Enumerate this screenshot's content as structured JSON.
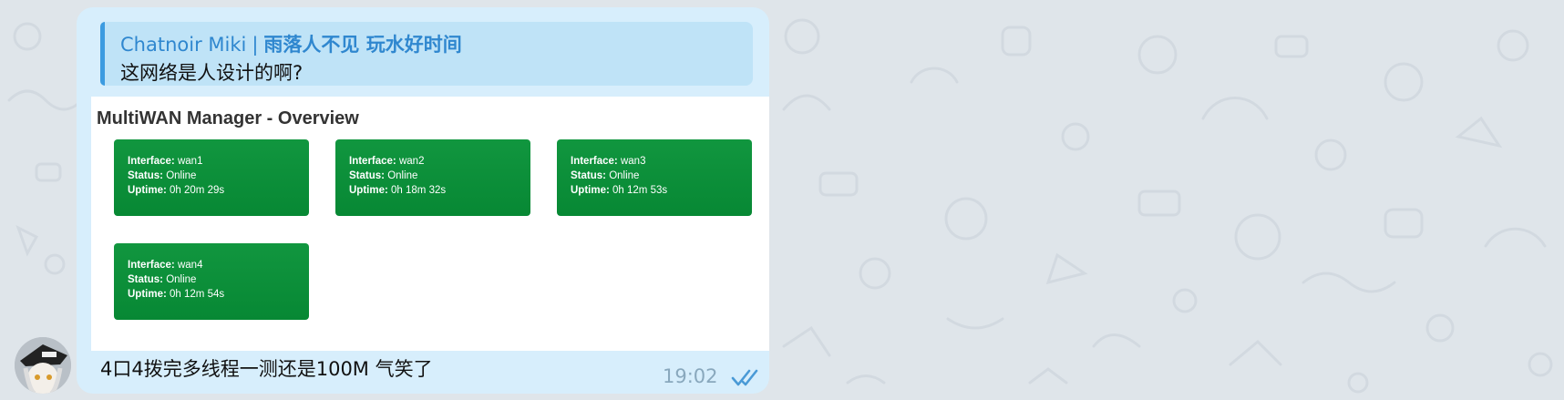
{
  "reply": {
    "sender": "Chatnoir Miki",
    "separator": "|",
    "sender_tail": "雨落人不见 玩水好时间",
    "text": "这网络是人设计的啊?"
  },
  "screenshot": {
    "title": "MultiWAN Manager - Overview",
    "cards": [
      {
        "interface_label": "Interface:",
        "interface": "wan1",
        "status_label": "Status:",
        "status": "Online",
        "uptime_label": "Uptime:",
        "uptime": "0h 20m 29s"
      },
      {
        "interface_label": "Interface:",
        "interface": "wan2",
        "status_label": "Status:",
        "status": "Online",
        "uptime_label": "Uptime:",
        "uptime": "0h 18m 32s"
      },
      {
        "interface_label": "Interface:",
        "interface": "wan3",
        "status_label": "Status:",
        "status": "Online",
        "uptime_label": "Uptime:",
        "uptime": "0h 12m 53s"
      },
      {
        "interface_label": "Interface:",
        "interface": "wan4",
        "status_label": "Status:",
        "status": "Online",
        "uptime_label": "Uptime:",
        "uptime": "0h 12m 54s"
      }
    ]
  },
  "message": {
    "text": "4口4拨完多线程一测还是100M 气笑了",
    "time": "19:02",
    "status_icon": "double-check-icon"
  },
  "colors": {
    "chat_background": "#dfe5ea",
    "bubble": "#d7eefc",
    "reply_background": "#bfe3f7",
    "accent": "#2f87cf",
    "card_green": "#0b8e39",
    "tick": "#4a9ad6"
  }
}
